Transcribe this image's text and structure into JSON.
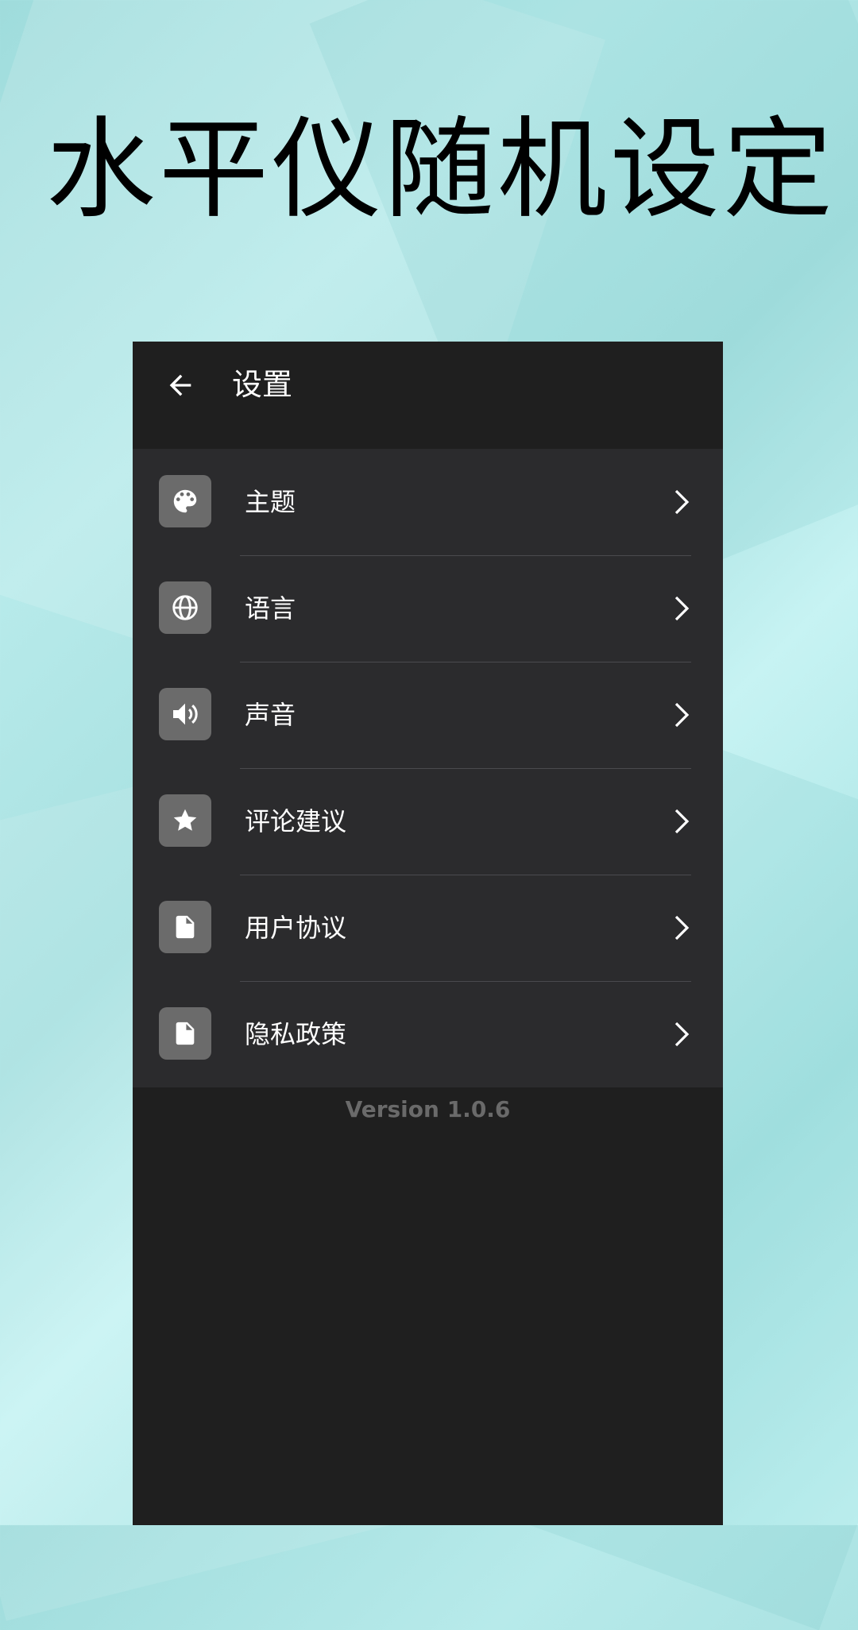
{
  "promo": {
    "title": "水平仪随机设定"
  },
  "appbar": {
    "title": "设置",
    "back_icon": "arrow-left-icon"
  },
  "settings": {
    "items": [
      {
        "label": "主题",
        "icon": "palette-icon"
      },
      {
        "label": "语言",
        "icon": "globe-icon"
      },
      {
        "label": "声音",
        "icon": "volume-icon"
      },
      {
        "label": "评论建议",
        "icon": "star-icon"
      },
      {
        "label": "用户协议",
        "icon": "document-icon"
      },
      {
        "label": "隐私政策",
        "icon": "document-icon"
      }
    ]
  },
  "footer": {
    "version": "Version 1.0.6"
  },
  "colors": {
    "appbar_bg": "#1f1f1f",
    "list_bg": "#2b2b2d",
    "icon_box_bg": "#6b6b6b",
    "divider": "#4a4a4e",
    "version_text": "#6a6a6a",
    "background": "#b7eaea"
  }
}
